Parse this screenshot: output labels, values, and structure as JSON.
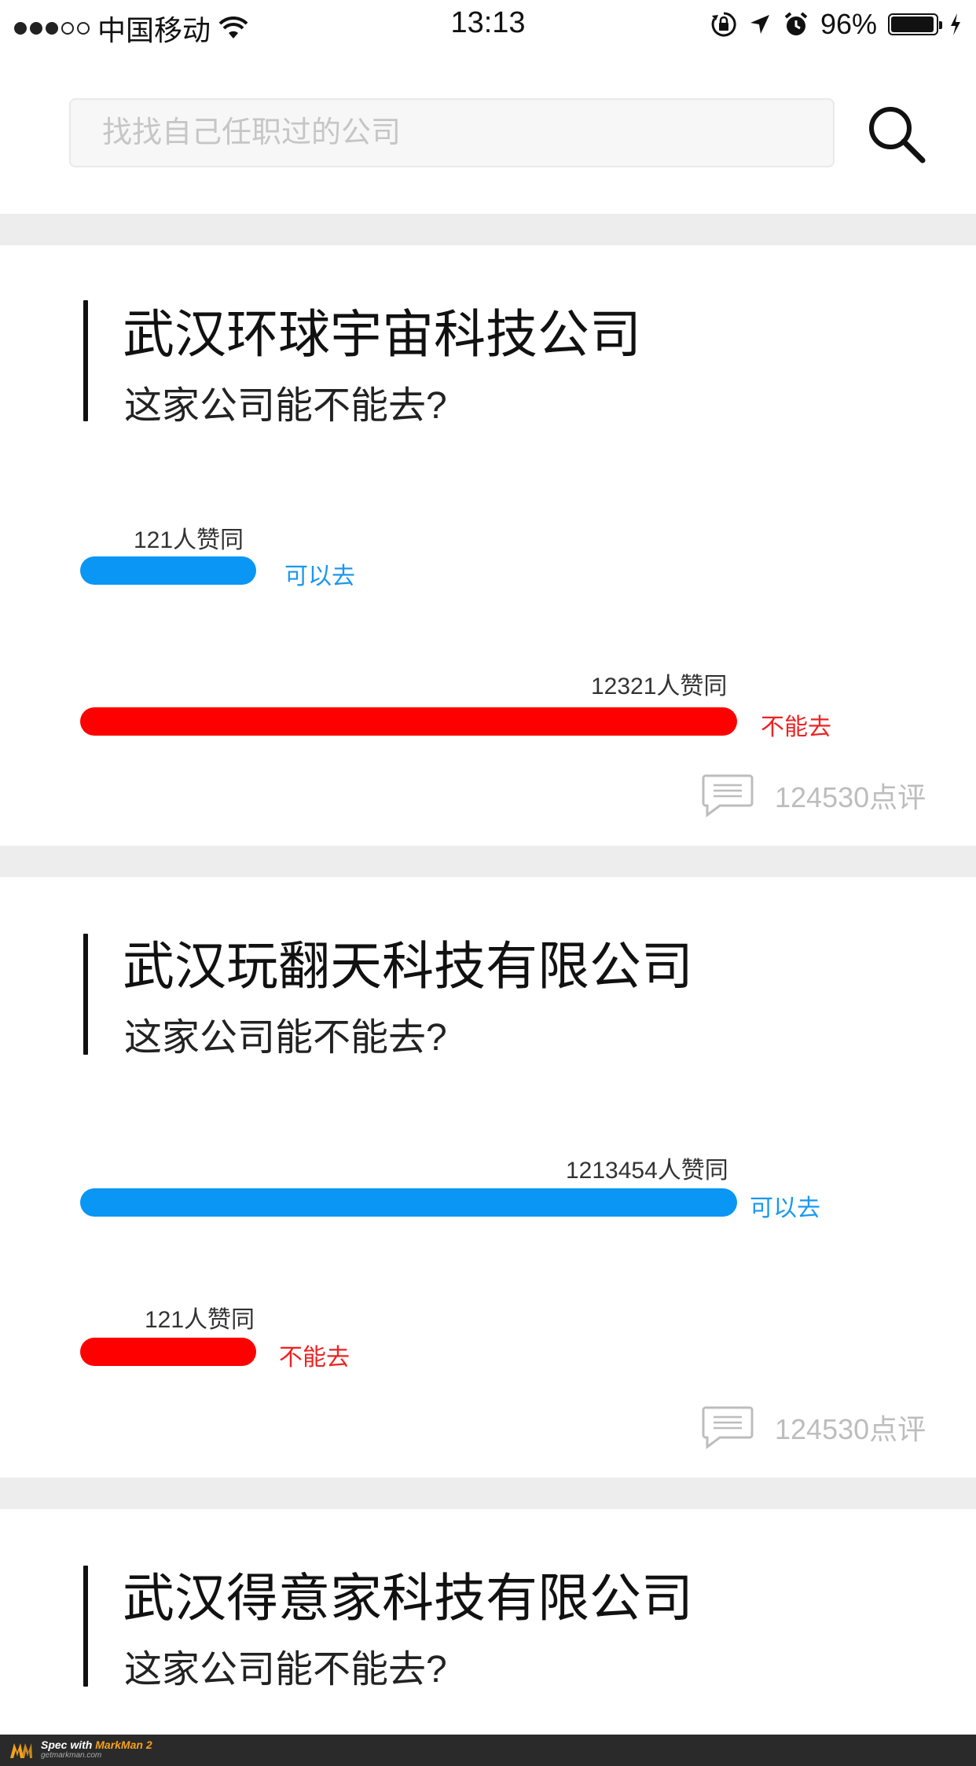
{
  "status_bar": {
    "carrier": "中国移动",
    "time": "13:13",
    "battery_percent": "96%",
    "battery_level": 0.96,
    "signal_strength": 3,
    "signal_total": 5,
    "icons": [
      "wifi-icon",
      "orientation-lock-icon",
      "location-icon",
      "alarm-icon",
      "charging-icon"
    ]
  },
  "search": {
    "placeholder": "找找自己任职过的公司",
    "value": "",
    "icon": "search-icon"
  },
  "colors": {
    "yes": "#0a96f5",
    "no": "#fe0000",
    "search_bg": "#f7f7f7",
    "search_border": "#e9e9e9",
    "separator": "#ededed"
  },
  "companies": [
    {
      "name": "武汉环球宇宙科技公司",
      "question": "这家公司能不能去?",
      "yes": {
        "count_label": "121人赞同",
        "label": "可以去",
        "count": 121
      },
      "no": {
        "count_label": "12321人赞同",
        "label": "不能去",
        "count": 12321
      },
      "comments": {
        "count": "124530点评",
        "icon": "comment-icon"
      }
    },
    {
      "name": "武汉玩翻天科技有限公司",
      "question": "这家公司能不能去?",
      "yes": {
        "count_label": "1213454人赞同",
        "label": "可以去",
        "count": 1213454
      },
      "no": {
        "count_label": "121人赞同",
        "label": "不能去",
        "count": 121
      },
      "comments": {
        "count": "124530点评",
        "icon": "comment-icon"
      }
    },
    {
      "name": "武汉得意家科技有限公司",
      "question": "这家公司能不能去?"
    }
  ],
  "branding": {
    "prefix": "Spec with",
    "product": "MarkMan 2",
    "site": "getmarkman.com"
  }
}
